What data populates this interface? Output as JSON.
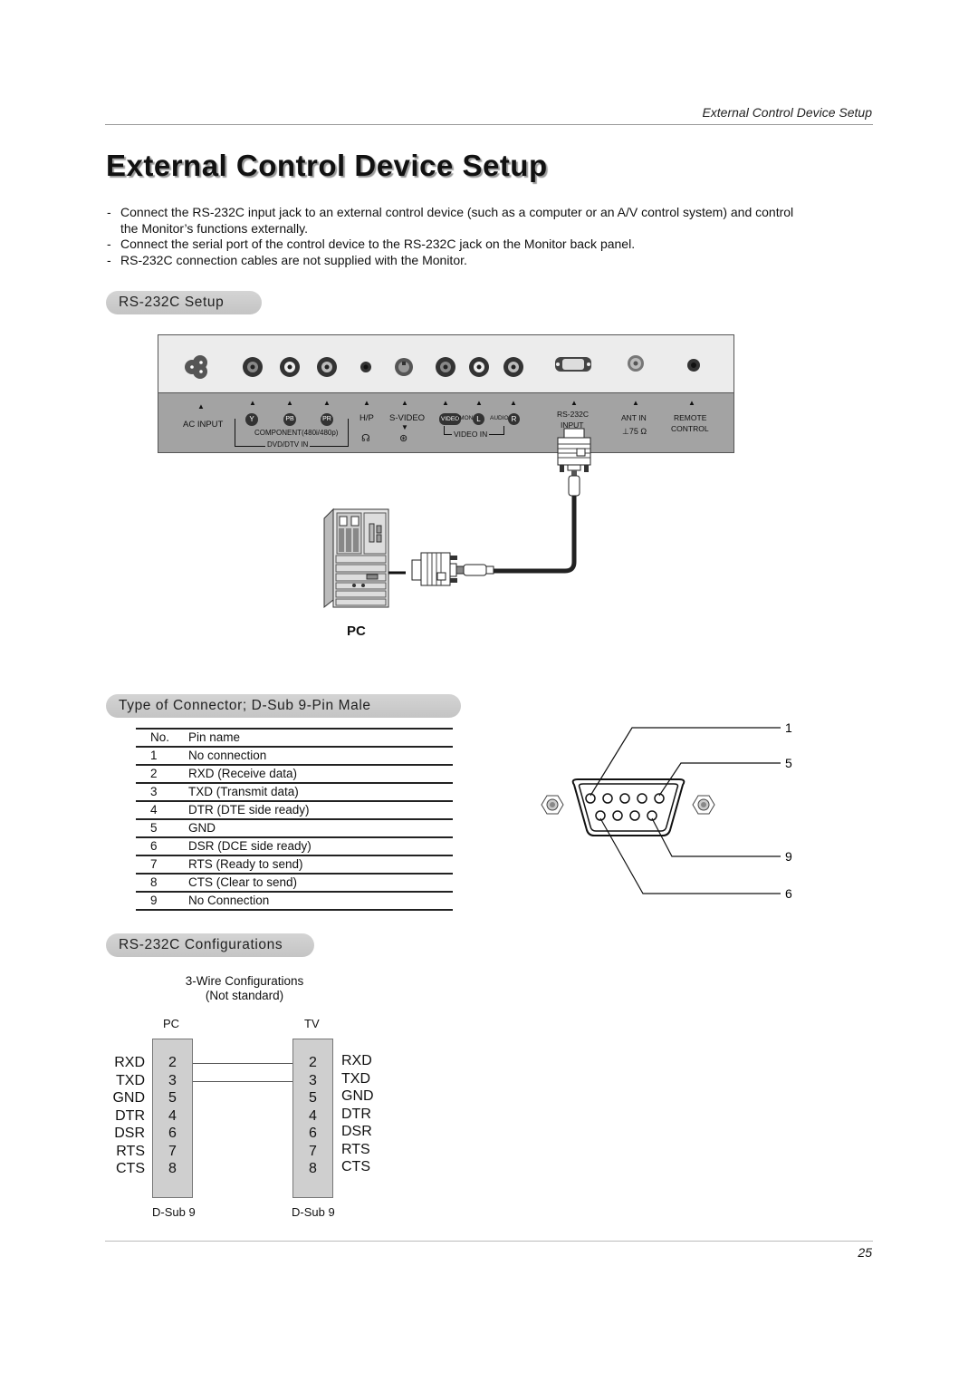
{
  "running_head": "External Control Device Setup",
  "page_title": "External Control Device Setup",
  "bullets": [
    {
      "dash": "-",
      "text": "Connect the RS-232C input jack to an external control device (such as a computer or an A/V control system) and control the Monitor’s functions externally."
    },
    {
      "dash": "-",
      "text": "Connect the serial port of the control device to the RS-232C jack on the Monitor back panel."
    },
    {
      "dash": "-",
      "text": "RS-232C connection cables are not supplied with the Monitor."
    }
  ],
  "sections": {
    "setup": "RS-232C Setup",
    "connector": "Type of Connector; D-Sub 9-Pin Male",
    "configurations": "RS-232C Configurations"
  },
  "panel": {
    "ac_input": "AC INPUT",
    "y": "Y",
    "pb": "PB",
    "pr": "PR",
    "component": "COMPONENT(480i/480p)",
    "dvd_dtv_in": "DVD/DTV IN",
    "hp": "H/P",
    "s_video": "S-VIDEO",
    "video": "VIDEO",
    "mono": "(MONO)",
    "l": "L",
    "audio": "AUDIO",
    "r": "R",
    "video_in": "VIDEO IN",
    "rs232c": "RS-232C",
    "input": "INPUT",
    "ant_in": "ANT IN",
    "ohm": "75 Ω",
    "remote": "REMOTE",
    "control": "CONTROL"
  },
  "pc_label": "PC",
  "pin_table": {
    "headers": [
      "No.",
      "Pin name"
    ],
    "rows": [
      [
        "1",
        "No connection"
      ],
      [
        "2",
        "RXD (Receive data)"
      ],
      [
        "3",
        "TXD (Transmit data)"
      ],
      [
        "4",
        "DTR (DTE side ready)"
      ],
      [
        "5",
        "GND"
      ],
      [
        "6",
        "DSR (DCE side ready)"
      ],
      [
        "7",
        "RTS (Ready to send)"
      ],
      [
        "8",
        "CTS (Clear to send)"
      ],
      [
        "9",
        "No Connection"
      ]
    ]
  },
  "pin_diagram": {
    "labels": [
      "1",
      "5",
      "9",
      "6"
    ]
  },
  "config": {
    "title_line1": "3-Wire Configurations",
    "title_line2": "(Not standard)",
    "pc": "PC",
    "tv": "TV",
    "signals": [
      "RXD",
      "TXD",
      "GND",
      "DTR",
      "DSR",
      "RTS",
      "CTS"
    ],
    "pins": [
      "2",
      "3",
      "5",
      "4",
      "6",
      "7",
      "8"
    ],
    "connector_label": "D-Sub 9"
  },
  "page_number": "25"
}
